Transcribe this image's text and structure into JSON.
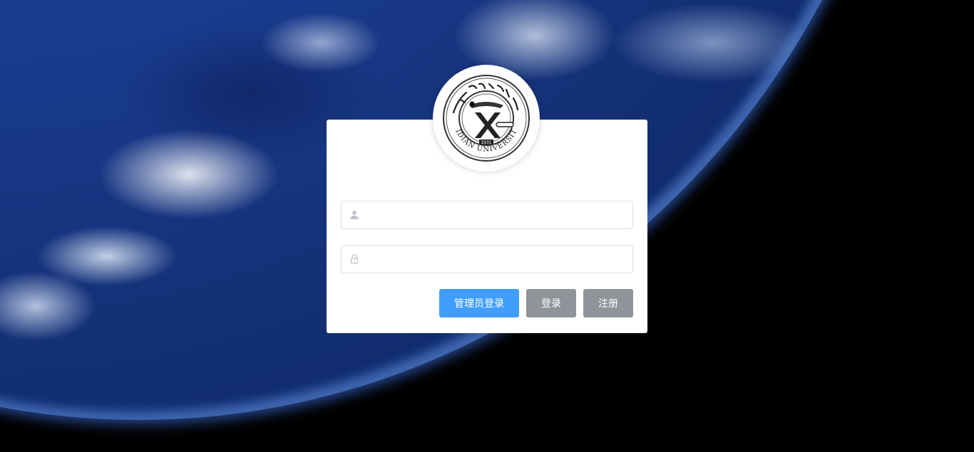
{
  "background": {
    "description_icon": "earth-from-space"
  },
  "logo": {
    "icon": "university-seal-icon",
    "seal_text": "XIDIAN UNIVERSITY",
    "seal_year": "1931"
  },
  "form": {
    "username": {
      "value": "",
      "placeholder": "",
      "icon": "user-icon"
    },
    "password": {
      "value": "",
      "placeholder": "",
      "icon": "lock-icon"
    }
  },
  "buttons": {
    "admin_login": "管理员登录",
    "login": "登录",
    "register": "注册"
  },
  "colors": {
    "primary": "#409eff",
    "secondary": "#909399",
    "card_bg": "#ffffff",
    "input_border": "#dcdfe6"
  }
}
